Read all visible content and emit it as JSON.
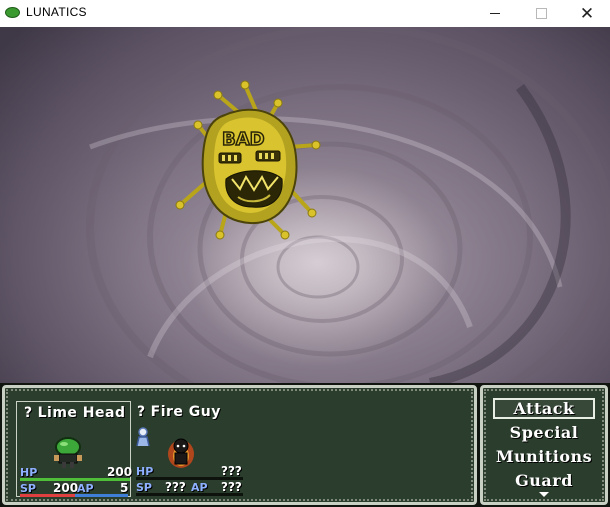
{
  "window": {
    "title": "LUNATICS",
    "icon": "green-slime-icon",
    "minimize_icon": "minimize-icon",
    "maximize_icon": "maximize-icon",
    "close_icon": "close-icon",
    "close_glyph": "✕"
  },
  "enemy": {
    "face_text": "BAD",
    "sprite": "yellow-spiky-head-enemy"
  },
  "party": [
    {
      "prefix": "?",
      "name": "Lime Head",
      "hp_label": "HP",
      "hp": "200",
      "hp_fraction": 1.0,
      "sp_label": "SP",
      "sp": "200",
      "sp_fraction": 1.0,
      "ap_label": "AP",
      "ap": "5",
      "ap_fraction": 1.0,
      "sprite": "lime-head-sprite",
      "selected": true
    },
    {
      "prefix": "?",
      "name": "Fire Guy",
      "hp_label": "HP",
      "hp": "???",
      "sp_label": "SP",
      "sp": "???",
      "ap_label": "AP",
      "ap": "???",
      "state_icon": "person-state-icon",
      "sprite": "fire-guy-sprite",
      "selected": false
    }
  ],
  "commands": [
    "Attack",
    "Special",
    "Munitions",
    "Guard"
  ],
  "selected_command": "Attack",
  "colors": {
    "hp_bar": "#4fbf3a",
    "sp_bar": "#e04040",
    "ap_bar": "#3f7fd8",
    "window_bg": "#2b3d2c"
  }
}
